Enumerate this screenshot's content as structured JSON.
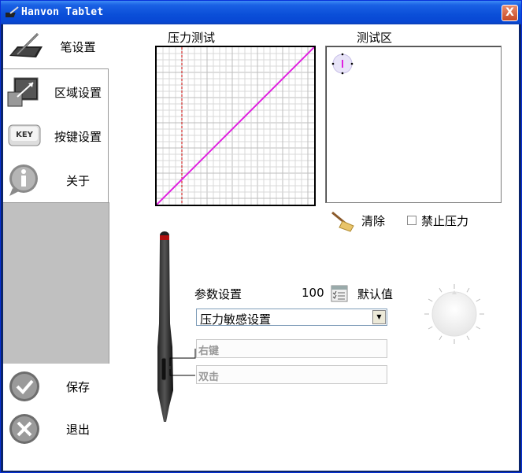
{
  "window": {
    "title": "Hanvon Tablet",
    "close_label": "X"
  },
  "sidebar": {
    "items": [
      {
        "label": "笔设置"
      },
      {
        "label": "区域设置"
      },
      {
        "label": "按键设置",
        "key_text": "KEY"
      },
      {
        "label": "关于"
      }
    ],
    "save_label": "保存",
    "exit_label": "退出"
  },
  "pressure_test": {
    "title": "压力测试"
  },
  "test_area": {
    "title": "测试区"
  },
  "clear_label": "清除",
  "disable_pressure": {
    "label": "禁止压力",
    "checked": false
  },
  "params": {
    "label": "参数设置",
    "value": "100",
    "default_label": "默认值",
    "selected_option": "压力敏感设置"
  },
  "buttons": {
    "right_key": "右键",
    "double_click": "双击"
  },
  "colors": {
    "curve": "#e020e0",
    "grid": "#d8d8d8",
    "marker": "#cc0000"
  }
}
